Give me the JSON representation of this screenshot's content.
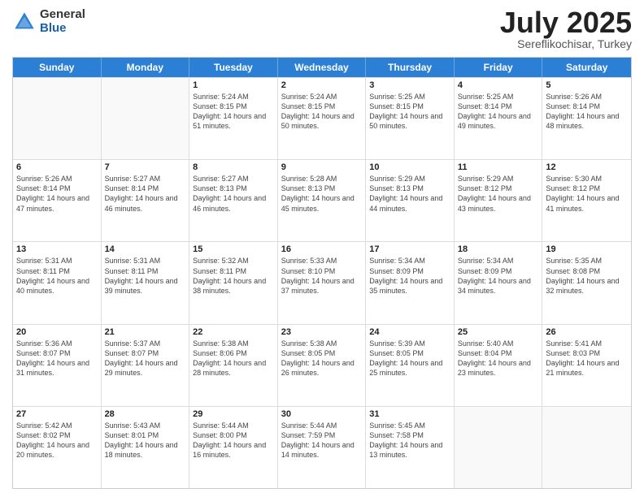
{
  "logo": {
    "general": "General",
    "blue": "Blue"
  },
  "title": "July 2025",
  "location": "Sereflikochisar, Turkey",
  "days_of_week": [
    "Sunday",
    "Monday",
    "Tuesday",
    "Wednesday",
    "Thursday",
    "Friday",
    "Saturday"
  ],
  "weeks": [
    [
      {
        "day": "",
        "empty": true
      },
      {
        "day": "",
        "empty": true
      },
      {
        "day": "1",
        "sunrise": "Sunrise: 5:24 AM",
        "sunset": "Sunset: 8:15 PM",
        "daylight": "Daylight: 14 hours and 51 minutes."
      },
      {
        "day": "2",
        "sunrise": "Sunrise: 5:24 AM",
        "sunset": "Sunset: 8:15 PM",
        "daylight": "Daylight: 14 hours and 50 minutes."
      },
      {
        "day": "3",
        "sunrise": "Sunrise: 5:25 AM",
        "sunset": "Sunset: 8:15 PM",
        "daylight": "Daylight: 14 hours and 50 minutes."
      },
      {
        "day": "4",
        "sunrise": "Sunrise: 5:25 AM",
        "sunset": "Sunset: 8:14 PM",
        "daylight": "Daylight: 14 hours and 49 minutes."
      },
      {
        "day": "5",
        "sunrise": "Sunrise: 5:26 AM",
        "sunset": "Sunset: 8:14 PM",
        "daylight": "Daylight: 14 hours and 48 minutes."
      }
    ],
    [
      {
        "day": "6",
        "sunrise": "Sunrise: 5:26 AM",
        "sunset": "Sunset: 8:14 PM",
        "daylight": "Daylight: 14 hours and 47 minutes."
      },
      {
        "day": "7",
        "sunrise": "Sunrise: 5:27 AM",
        "sunset": "Sunset: 8:14 PM",
        "daylight": "Daylight: 14 hours and 46 minutes."
      },
      {
        "day": "8",
        "sunrise": "Sunrise: 5:27 AM",
        "sunset": "Sunset: 8:13 PM",
        "daylight": "Daylight: 14 hours and 46 minutes."
      },
      {
        "day": "9",
        "sunrise": "Sunrise: 5:28 AM",
        "sunset": "Sunset: 8:13 PM",
        "daylight": "Daylight: 14 hours and 45 minutes."
      },
      {
        "day": "10",
        "sunrise": "Sunrise: 5:29 AM",
        "sunset": "Sunset: 8:13 PM",
        "daylight": "Daylight: 14 hours and 44 minutes."
      },
      {
        "day": "11",
        "sunrise": "Sunrise: 5:29 AM",
        "sunset": "Sunset: 8:12 PM",
        "daylight": "Daylight: 14 hours and 43 minutes."
      },
      {
        "day": "12",
        "sunrise": "Sunrise: 5:30 AM",
        "sunset": "Sunset: 8:12 PM",
        "daylight": "Daylight: 14 hours and 41 minutes."
      }
    ],
    [
      {
        "day": "13",
        "sunrise": "Sunrise: 5:31 AM",
        "sunset": "Sunset: 8:11 PM",
        "daylight": "Daylight: 14 hours and 40 minutes."
      },
      {
        "day": "14",
        "sunrise": "Sunrise: 5:31 AM",
        "sunset": "Sunset: 8:11 PM",
        "daylight": "Daylight: 14 hours and 39 minutes."
      },
      {
        "day": "15",
        "sunrise": "Sunrise: 5:32 AM",
        "sunset": "Sunset: 8:11 PM",
        "daylight": "Daylight: 14 hours and 38 minutes."
      },
      {
        "day": "16",
        "sunrise": "Sunrise: 5:33 AM",
        "sunset": "Sunset: 8:10 PM",
        "daylight": "Daylight: 14 hours and 37 minutes."
      },
      {
        "day": "17",
        "sunrise": "Sunrise: 5:34 AM",
        "sunset": "Sunset: 8:09 PM",
        "daylight": "Daylight: 14 hours and 35 minutes."
      },
      {
        "day": "18",
        "sunrise": "Sunrise: 5:34 AM",
        "sunset": "Sunset: 8:09 PM",
        "daylight": "Daylight: 14 hours and 34 minutes."
      },
      {
        "day": "19",
        "sunrise": "Sunrise: 5:35 AM",
        "sunset": "Sunset: 8:08 PM",
        "daylight": "Daylight: 14 hours and 32 minutes."
      }
    ],
    [
      {
        "day": "20",
        "sunrise": "Sunrise: 5:36 AM",
        "sunset": "Sunset: 8:07 PM",
        "daylight": "Daylight: 14 hours and 31 minutes."
      },
      {
        "day": "21",
        "sunrise": "Sunrise: 5:37 AM",
        "sunset": "Sunset: 8:07 PM",
        "daylight": "Daylight: 14 hours and 29 minutes."
      },
      {
        "day": "22",
        "sunrise": "Sunrise: 5:38 AM",
        "sunset": "Sunset: 8:06 PM",
        "daylight": "Daylight: 14 hours and 28 minutes."
      },
      {
        "day": "23",
        "sunrise": "Sunrise: 5:38 AM",
        "sunset": "Sunset: 8:05 PM",
        "daylight": "Daylight: 14 hours and 26 minutes."
      },
      {
        "day": "24",
        "sunrise": "Sunrise: 5:39 AM",
        "sunset": "Sunset: 8:05 PM",
        "daylight": "Daylight: 14 hours and 25 minutes."
      },
      {
        "day": "25",
        "sunrise": "Sunrise: 5:40 AM",
        "sunset": "Sunset: 8:04 PM",
        "daylight": "Daylight: 14 hours and 23 minutes."
      },
      {
        "day": "26",
        "sunrise": "Sunrise: 5:41 AM",
        "sunset": "Sunset: 8:03 PM",
        "daylight": "Daylight: 14 hours and 21 minutes."
      }
    ],
    [
      {
        "day": "27",
        "sunrise": "Sunrise: 5:42 AM",
        "sunset": "Sunset: 8:02 PM",
        "daylight": "Daylight: 14 hours and 20 minutes."
      },
      {
        "day": "28",
        "sunrise": "Sunrise: 5:43 AM",
        "sunset": "Sunset: 8:01 PM",
        "daylight": "Daylight: 14 hours and 18 minutes."
      },
      {
        "day": "29",
        "sunrise": "Sunrise: 5:44 AM",
        "sunset": "Sunset: 8:00 PM",
        "daylight": "Daylight: 14 hours and 16 minutes."
      },
      {
        "day": "30",
        "sunrise": "Sunrise: 5:44 AM",
        "sunset": "Sunset: 7:59 PM",
        "daylight": "Daylight: 14 hours and 14 minutes."
      },
      {
        "day": "31",
        "sunrise": "Sunrise: 5:45 AM",
        "sunset": "Sunset: 7:58 PM",
        "daylight": "Daylight: 14 hours and 13 minutes."
      },
      {
        "day": "",
        "empty": true
      },
      {
        "day": "",
        "empty": true
      }
    ]
  ]
}
